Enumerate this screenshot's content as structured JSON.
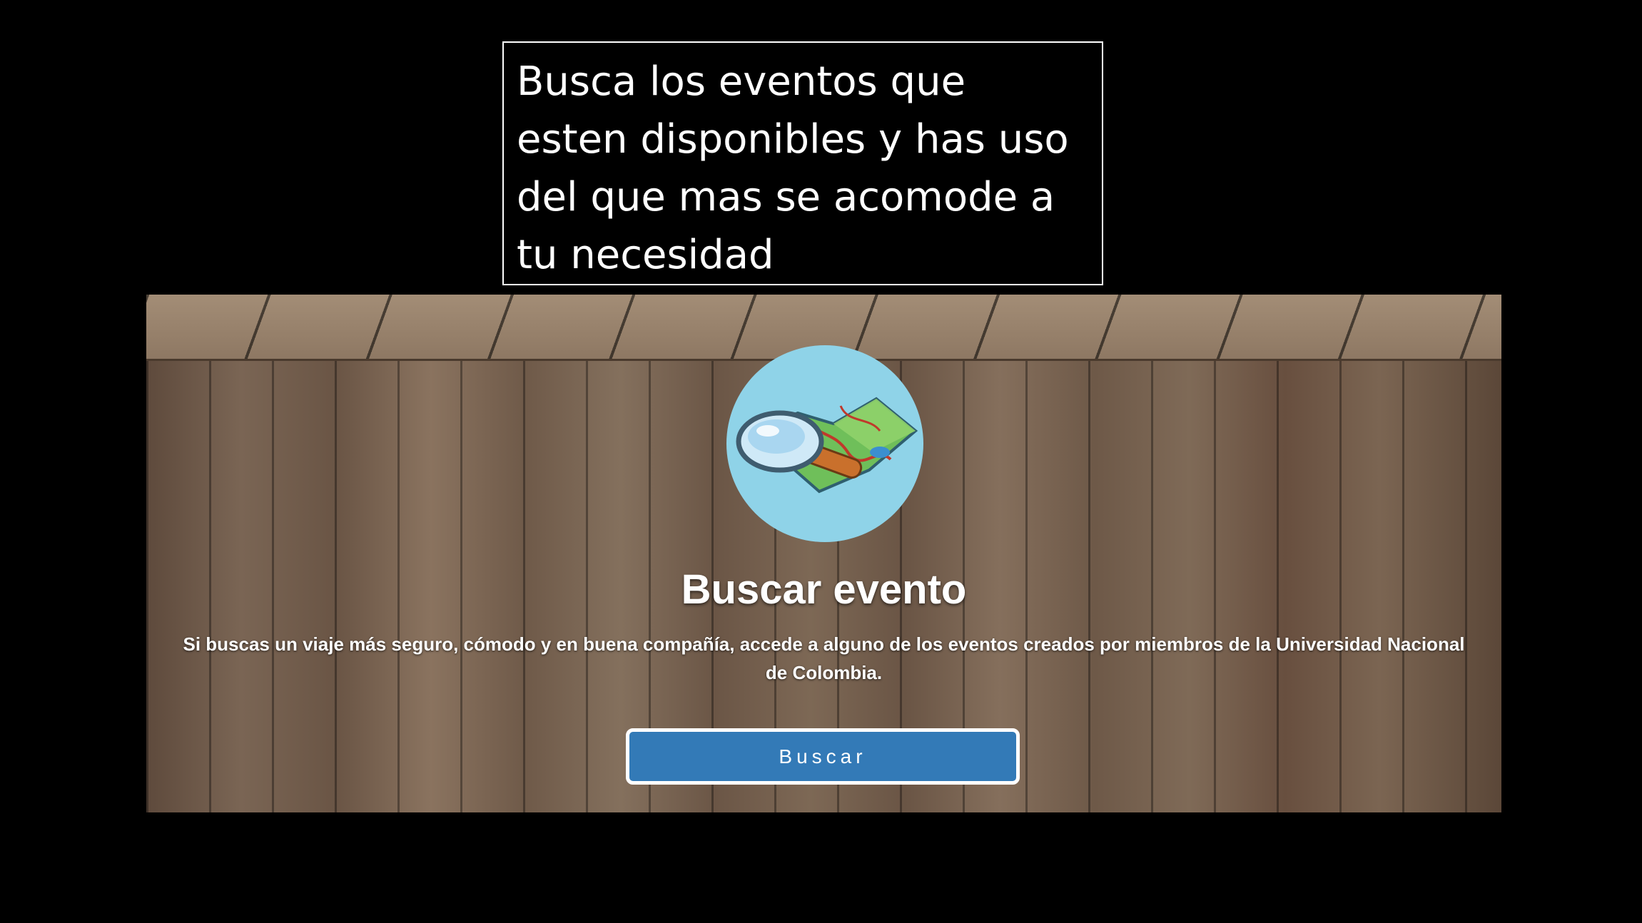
{
  "callout": {
    "text": "Busca los eventos que esten disponibles y has uso del que mas se acomode a tu necesidad"
  },
  "card": {
    "icon": "map-search-icon",
    "title": "Buscar evento",
    "description": "Si buscas un viaje más seguro, cómodo y en buena compañía, accede a alguno de los eventos creados por miembros de la Universidad Nacional de Colombia.",
    "button_label": "Buscar"
  },
  "colors": {
    "background": "#000000",
    "button": "#337ab7",
    "icon_circle": "#8fd3e8"
  }
}
